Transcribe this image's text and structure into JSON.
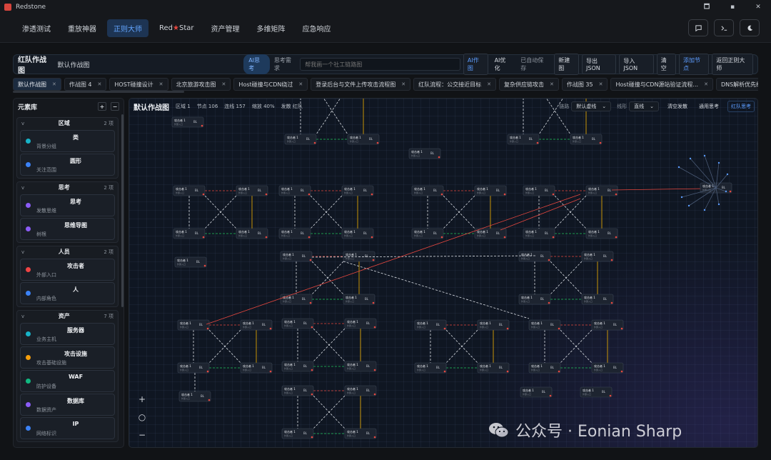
{
  "window": {
    "title": "Redstone",
    "controls": [
      "🗖",
      "▪",
      "✕"
    ]
  },
  "nav": {
    "items": [
      "渗透测试",
      "重放神器",
      "正则大师",
      "Red",
      "Star",
      "资产管理",
      "多维矩阵",
      "应急响应"
    ],
    "right_icons": [
      "chat-icon",
      "terminal-icon",
      "moon-icon"
    ]
  },
  "toolbar": {
    "title": "红队作战图",
    "name_value": "默认作战图",
    "ai_think": "AI思考",
    "think_label": "思考需求",
    "think_placeholder": "帮我画一个社工链路图",
    "ai_graph": "AI作图",
    "ai_optimize": "AI优化",
    "autosave": "已自动保存",
    "new": "新建图",
    "export": "导出 JSON",
    "import": "导入 JSON",
    "clear": "清空",
    "add_node": "添加节点",
    "back": "返回正则大师"
  },
  "tabs": [
    "默认作战图",
    "作战图 4",
    "HOST碰撞设计",
    "北京旅游攻击图",
    "Host碰撞与CDN绕过",
    "登录后台与文件上传攻击流程图",
    "红队流程：公交接近目标",
    "复杂供应链攻击",
    "作战图 35",
    "Host碰撞与CDN源站验证流程...",
    "DNS解析优先级"
  ],
  "sidebar": {
    "title": "元素库",
    "add": "+",
    "remove": "−",
    "chevron": "v",
    "groups": [
      {
        "name": "区域",
        "count": "2 项",
        "items": [
          {
            "name": "类",
            "desc": "背景分组",
            "color": "#17b3c8"
          },
          {
            "name": "圆形",
            "desc": "关注范围",
            "color": "#3b82f6"
          }
        ]
      },
      {
        "name": "思考",
        "count": "2 项",
        "items": [
          {
            "name": "思考",
            "desc": "发散思维",
            "color": "#8b5cf6"
          },
          {
            "name": "思维导图",
            "desc": "树根",
            "color": "#8b5cf6"
          }
        ]
      },
      {
        "name": "人员",
        "count": "2 项",
        "items": [
          {
            "name": "攻击者",
            "desc": "外部入口",
            "color": "#ef4444"
          },
          {
            "name": "人",
            "desc": "内部角色",
            "color": "#3b82f6"
          }
        ]
      },
      {
        "name": "资产",
        "count": "7 项",
        "items": [
          {
            "name": "服务器",
            "desc": "业务主机",
            "color": "#17b3c8"
          },
          {
            "name": "攻击设施",
            "desc": "攻击基础设施",
            "color": "#f59e0b"
          },
          {
            "name": "WAF",
            "desc": "防护设备",
            "color": "#10b981"
          },
          {
            "name": "数据库",
            "desc": "数据资产",
            "color": "#8b5cf6"
          },
          {
            "name": "IP",
            "desc": "网络标识",
            "color": "#3b82f6"
          }
        ]
      }
    ]
  },
  "canvas": {
    "title": "默认作战图",
    "stats": [
      "区域 1",
      "节点 106",
      "连线 157",
      "缩放 40%",
      "发散 红队"
    ],
    "link_label": "链路",
    "link_value": "默认虚线",
    "line_label": "线形",
    "line_value": "直线",
    "clear_divergence": "清空发散",
    "general_think": "通用思考",
    "redteam_think": "红队思考",
    "zoom_in": "+",
    "zoom_reset": "○",
    "zoom_out": "−",
    "node_label": "攻击者 1",
    "node_sub": "外部入口",
    "node_tag": "BL",
    "colors": {
      "dashed": "#d9dde3",
      "attack": "#e5473f",
      "flow": "#f5b400",
      "waf": "#22c55e"
    }
  },
  "watermark": {
    "text": "公众号 · Eonian Sharp"
  }
}
